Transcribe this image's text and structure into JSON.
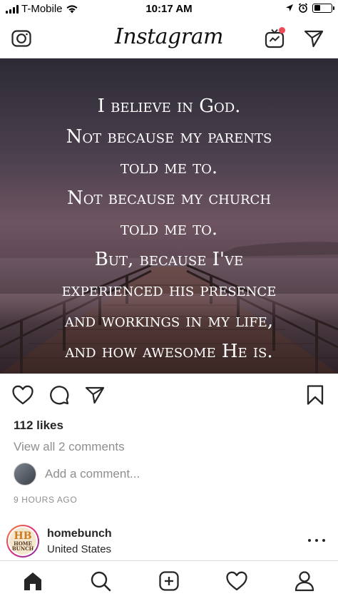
{
  "status_bar": {
    "carrier": "T-Mobile",
    "time": "10:17 AM",
    "battery_level": 0.35
  },
  "app": {
    "logo": "Instagram",
    "icons": [
      "camera-icon",
      "igtv-icon",
      "direct-message-icon"
    ]
  },
  "post": {
    "image_text": [
      "I believe in God.",
      "Not because my parents",
      "told me to.",
      "Not because my church",
      "told me to.",
      "But, because I've",
      "experienced his presence",
      "and workings in my life,",
      "and how awesome He is."
    ],
    "likes": "112 likes",
    "view_comments": "View all 2 comments",
    "comment_placeholder": "Add a comment...",
    "timestamp": "9 HOURS AGO"
  },
  "next_post": {
    "avatar_text": [
      "HB",
      "HOME",
      "BUNCH"
    ],
    "username": "homebunch",
    "location": "United States"
  },
  "tab_bar": {
    "items": [
      "home-icon",
      "search-icon",
      "new-post-icon",
      "activity-icon",
      "profile-icon"
    ],
    "active": "home-icon"
  }
}
